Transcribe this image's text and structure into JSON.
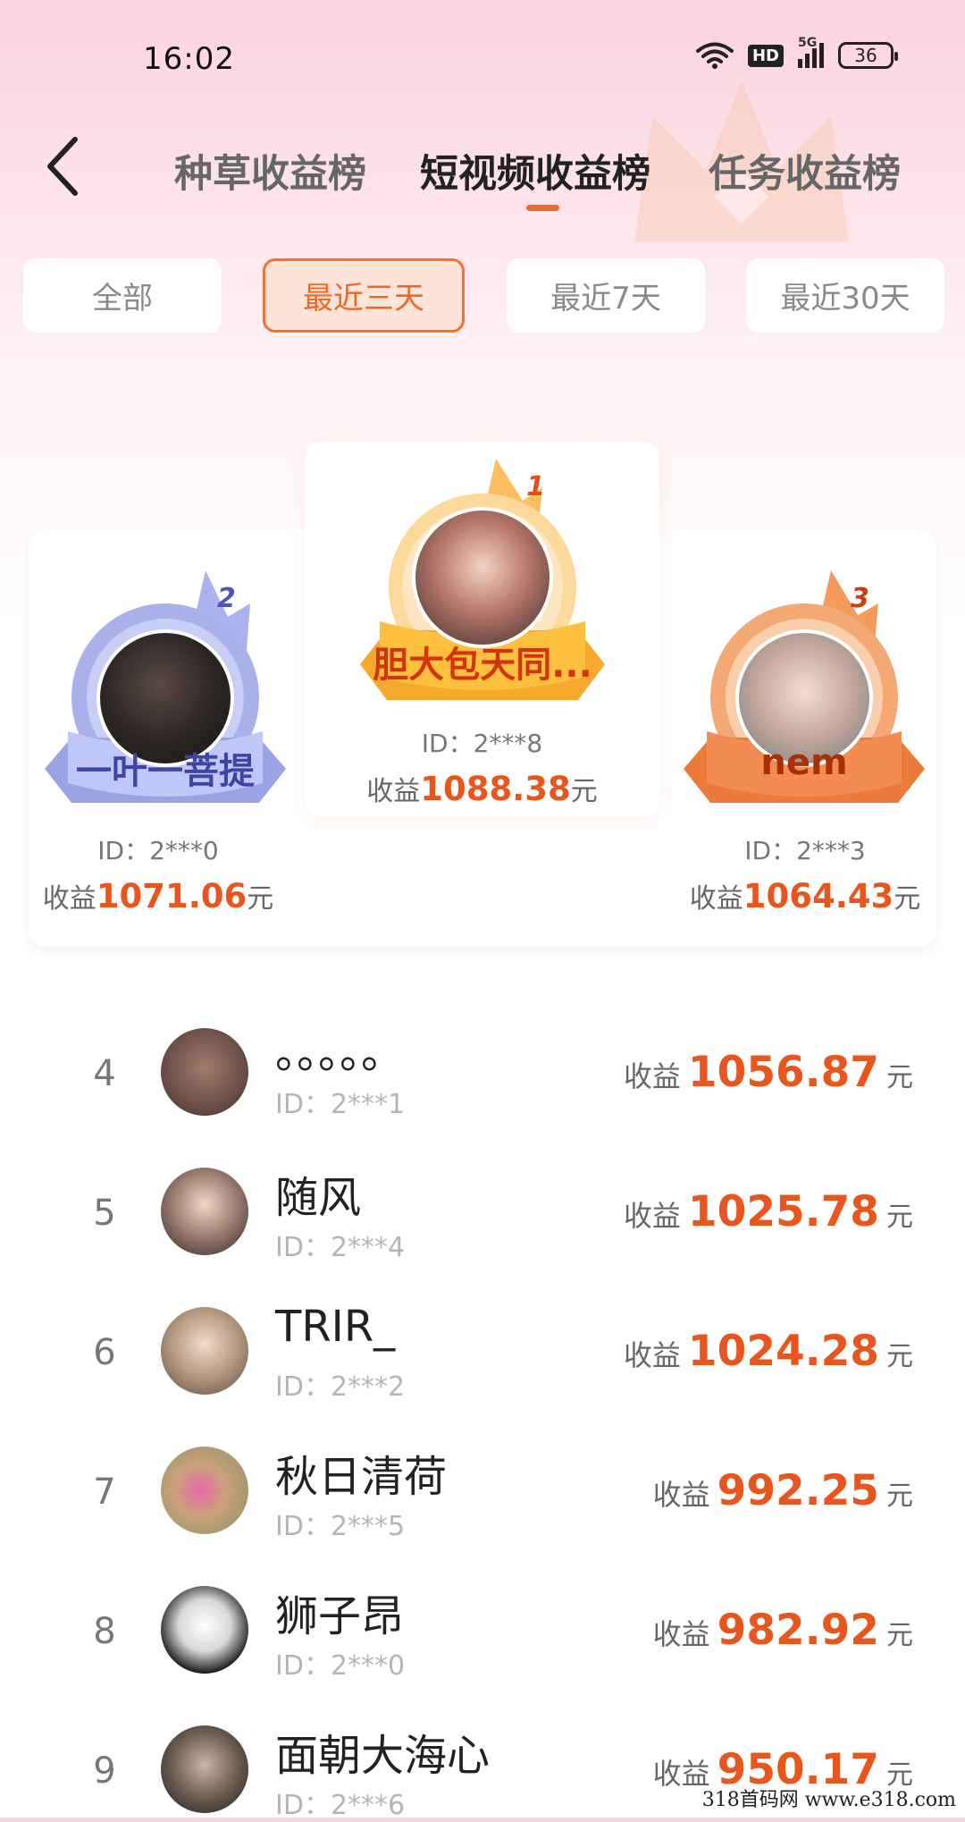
{
  "status_bar": {
    "time": "16:02",
    "network": "5G",
    "hd": "HD",
    "battery": "36"
  },
  "nav": {
    "tabs": [
      {
        "label": "种草收益榜"
      },
      {
        "label": "短视频收益榜"
      },
      {
        "label": "任务收益榜"
      }
    ],
    "active_tab": 1
  },
  "filters": {
    "items": [
      {
        "label": "全部"
      },
      {
        "label": "最近三天"
      },
      {
        "label": "最近7天"
      },
      {
        "label": "最近30天"
      }
    ],
    "active": 1
  },
  "podium": {
    "first": {
      "rank": "1",
      "name": "胆大包天同...",
      "id": "ID：2***8",
      "earn_label": "收益",
      "amount": "1088.38",
      "unit": "元"
    },
    "second": {
      "rank": "2",
      "name": "一叶一菩提",
      "id": "ID：2***0",
      "earn_label": "收益",
      "amount": "1071.06",
      "unit": "元"
    },
    "third": {
      "rank": "3",
      "name": "nem",
      "id": "ID：2***3",
      "earn_label": "收益",
      "amount": "1064.43",
      "unit": "元"
    }
  },
  "list": [
    {
      "rank": "4",
      "name": "。。。。。",
      "id": "ID：2***1",
      "earn_label": "收益",
      "amount": "1056.87",
      "unit": "元"
    },
    {
      "rank": "5",
      "name": "随风",
      "id": "ID：2***4",
      "earn_label": "收益",
      "amount": "1025.78",
      "unit": "元"
    },
    {
      "rank": "6",
      "name": "TRIR_",
      "id": "ID：2***2",
      "earn_label": "收益",
      "amount": "1024.28",
      "unit": "元"
    },
    {
      "rank": "7",
      "name": "秋日清荷",
      "id": "ID：2***5",
      "earn_label": "收益",
      "amount": "992.25",
      "unit": "元"
    },
    {
      "rank": "8",
      "name": "狮子昂",
      "id": "ID：2***0",
      "earn_label": "收益",
      "amount": "982.92",
      "unit": "元"
    },
    {
      "rank": "9",
      "name": "面朝大海心",
      "id": "ID：2***6",
      "earn_label": "收益",
      "amount": "950.17",
      "unit": "元"
    }
  ],
  "watermark": "318首码网 www.e318.com",
  "colors": {
    "accent": "#f0692c",
    "amount": "#e8561e",
    "silver": "#9ea8e6",
    "gold": "#fbb03b",
    "bronze": "#f28a4c"
  }
}
